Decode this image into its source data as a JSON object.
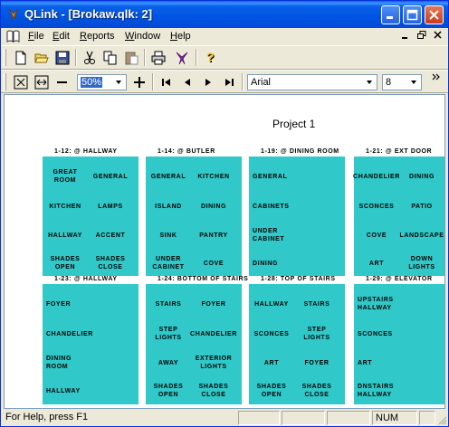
{
  "window": {
    "title": "QLink - [Brokaw.qlk: 2]"
  },
  "menubar": {
    "items": [
      "File",
      "Edit",
      "Reports",
      "Window",
      "Help"
    ]
  },
  "toolbar2": {
    "zoom_value": "50%",
    "font_value": "Arial",
    "size_value": "8"
  },
  "document": {
    "project_title": "Project 1"
  },
  "keypads": [
    {
      "label": "1-12: @ HALLWAY",
      "buttons": [
        "GREAT\nROOM",
        "GENERAL",
        "KITCHEN",
        "LAMPS",
        "HALLWAY",
        "ACCENT",
        "SHADES\nOPEN",
        "SHADES\nCLOSE"
      ]
    },
    {
      "label": "1-14: @ BUTLER",
      "buttons": [
        "GENERAL",
        "KITCHEN",
        "ISLAND",
        "DINING",
        "SINK",
        "PANTRY",
        "UNDER\nCABINET",
        "COVE"
      ]
    },
    {
      "label": "1-19: @ DINING ROOM",
      "buttons": [
        "GENERAL",
        "",
        "CABINETS",
        "",
        "UNDER\nCABINET",
        "",
        "DINING",
        ""
      ]
    },
    {
      "label": "1-21: @ EXT DOOR",
      "buttons": [
        "CHANDELIER",
        "DINING",
        "SCONCES",
        "PATIO",
        "COVE",
        "LANDSCAPE",
        "ART",
        "DOWN\nLIGHTS"
      ]
    },
    {
      "label": "1-23: @ HALLWAY",
      "buttons": [
        "FOYER",
        "",
        "CHANDELIER",
        "",
        "DINING\nROOM",
        "",
        "HALLWAY",
        ""
      ]
    },
    {
      "label": "1-24: BOTTOM OF STAIRS",
      "buttons": [
        "STAIRS",
        "FOYER",
        "STEP\nLIGHTS",
        "CHANDELIER",
        "AWAY",
        "EXTERIOR\nLIGHTS",
        "SHADES\nOPEN",
        "SHADES\nCLOSE"
      ]
    },
    {
      "label": "1-28: TOP OF STAIRS",
      "buttons": [
        "HALLWAY",
        "STAIRS",
        "SCONCES",
        "STEP\nLIGHTS",
        "ART",
        "FOYER",
        "SHADES\nOPEN",
        "SHADES\nCLOSE"
      ]
    },
    {
      "label": "1-29: @ ELEVATOR",
      "buttons": [
        "UPSTAIRS\nHALLWAY",
        "",
        "SCONCES",
        "",
        "ART",
        "",
        "DNSTAIRS\nHALLWAY",
        ""
      ]
    }
  ],
  "statusbar": {
    "help_text": "For Help, press F1",
    "num_indicator": "NUM"
  },
  "colors": {
    "keypad": "#30c8c8",
    "titlebar": "#0054e3"
  }
}
